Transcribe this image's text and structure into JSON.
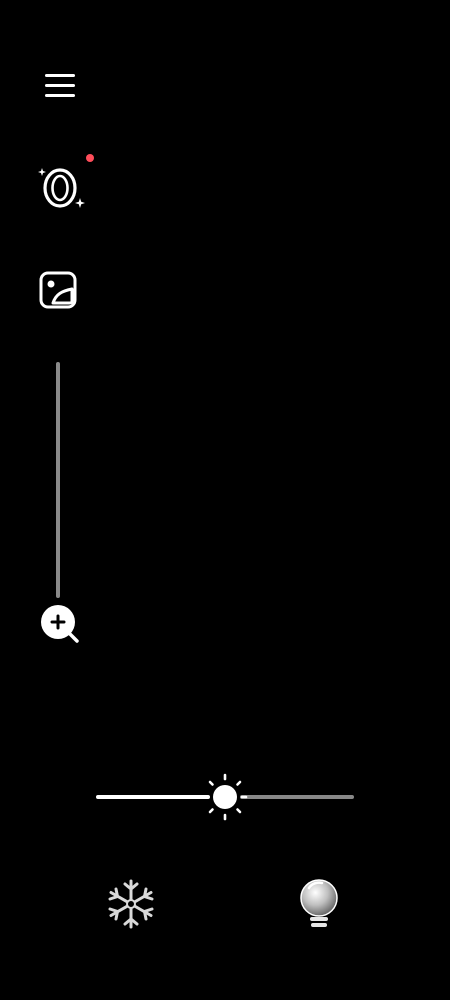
{
  "toolbar": {
    "menu_icon": "hamburger-menu-icon",
    "lens_icon": "sparkle-lens-icon",
    "gallery_icon": "gallery-image-icon",
    "zoom_icon": "zoom-in-icon",
    "notification_color": "#ff4d5a"
  },
  "zoom": {
    "level": 0
  },
  "brightness": {
    "level": 0.5,
    "icon": "sun-icon"
  },
  "bottom_bar": {
    "freeze_icon": "snowflake-icon",
    "bulb_icon": "light-bulb-icon"
  },
  "colors": {
    "background": "#000000",
    "foreground": "#ffffff",
    "track_inactive": "#888888"
  }
}
